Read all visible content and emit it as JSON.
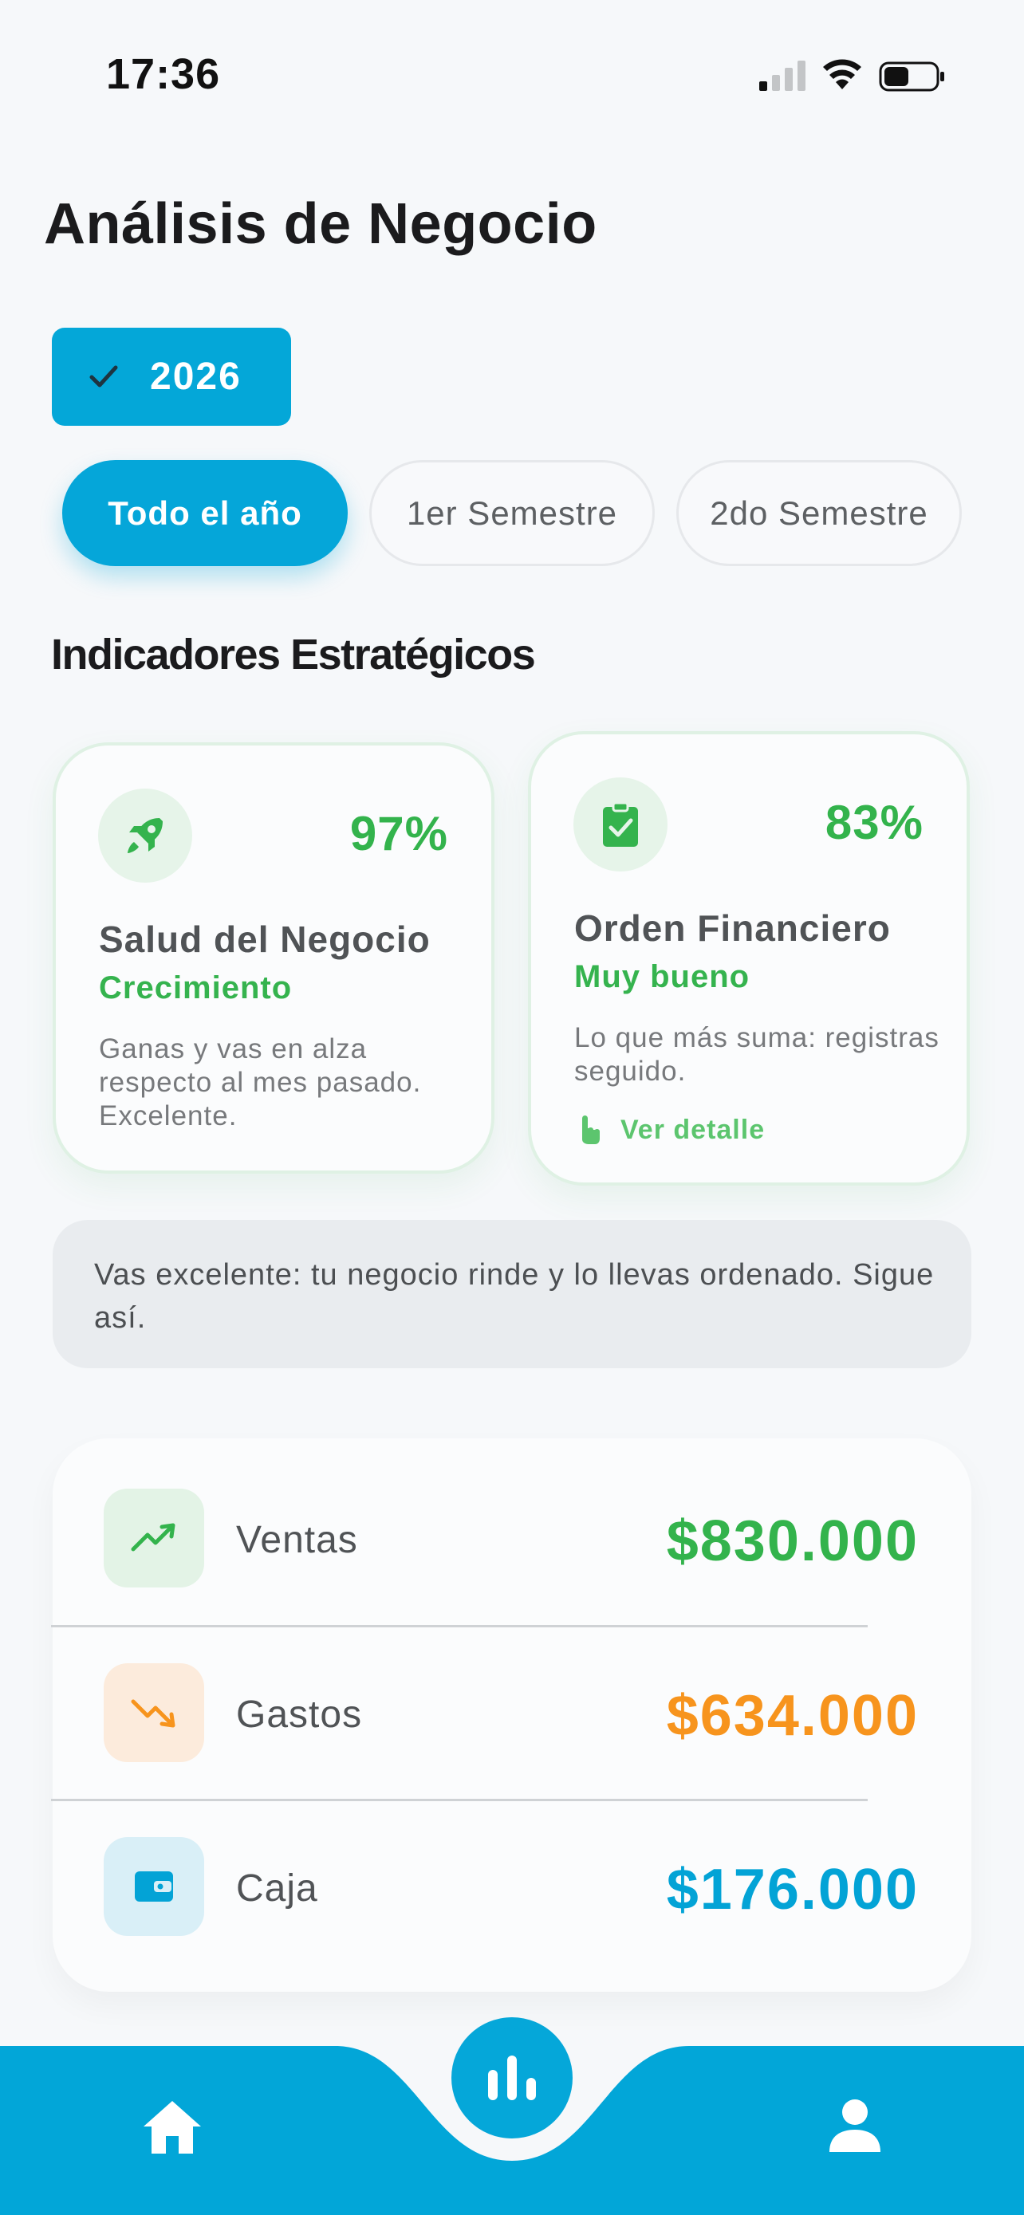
{
  "status_bar": {
    "time": "17:36"
  },
  "page": {
    "title": "Análisis de Negocio"
  },
  "year_filter": {
    "label": "2026"
  },
  "period_tabs": [
    {
      "label": "Todo el año",
      "active": true
    },
    {
      "label": "1er Semestre",
      "active": false
    },
    {
      "label": "2do Semestre",
      "active": false
    }
  ],
  "section": {
    "title": "Indicadores Estratégicos"
  },
  "kpis": [
    {
      "icon": "rocket-icon",
      "percent": "97%",
      "title": "Salud del Negocio",
      "status": "Crecimiento",
      "description": "Ganas y vas en alza respecto al mes pasado. Excelente."
    },
    {
      "icon": "clipboard-check-icon",
      "percent": "83%",
      "title": "Orden Financiero",
      "status": "Muy bueno",
      "description": "Lo que más suma: registras seguido.",
      "link_label": "Ver detalle"
    }
  ],
  "message": {
    "text": "Vas excelente: tu negocio rinde y lo llevas ordenado. Sigue así."
  },
  "summary": [
    {
      "label": "Ventas",
      "value": "$830.000",
      "icon": "trending-up-icon",
      "color": "#33b34c"
    },
    {
      "label": "Gastos",
      "value": "$634.000",
      "icon": "trending-down-icon",
      "color": "#f7941d"
    },
    {
      "label": "Caja",
      "value": "$176.000",
      "icon": "wallet-icon",
      "color": "#03a3d6"
    }
  ],
  "bottom_nav": [
    {
      "icon": "home-icon"
    },
    {
      "icon": "bar-chart-icon",
      "active": true
    },
    {
      "icon": "person-icon"
    }
  ],
  "colors": {
    "accent": "#05a6d9",
    "positive": "#33b34c",
    "expense": "#f7941d",
    "cash": "#03a3d6"
  }
}
